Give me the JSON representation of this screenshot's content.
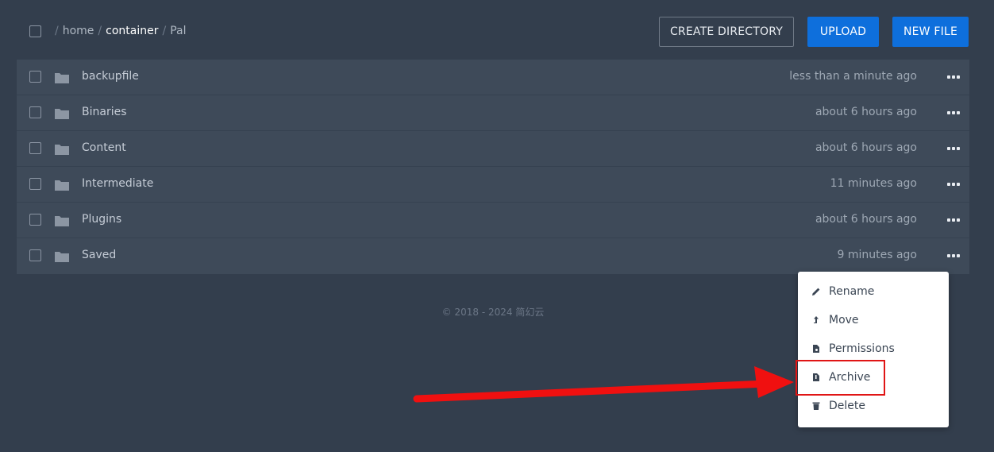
{
  "header": {
    "breadcrumb": {
      "sep": "/",
      "home": "home",
      "container": "container",
      "current": "Pal"
    },
    "buttons": {
      "create_directory": "CREATE DIRECTORY",
      "upload": "UPLOAD",
      "new_file": "NEW FILE"
    }
  },
  "files": [
    {
      "name": "backupfile",
      "modified": "less than a minute ago"
    },
    {
      "name": "Binaries",
      "modified": "about 6 hours ago"
    },
    {
      "name": "Content",
      "modified": "about 6 hours ago"
    },
    {
      "name": "Intermediate",
      "modified": "11 minutes ago"
    },
    {
      "name": "Plugins",
      "modified": "about 6 hours ago"
    },
    {
      "name": "Saved",
      "modified": "9 minutes ago"
    }
  ],
  "footer": {
    "text": "© 2018 - 2024 简幻云"
  },
  "context_menu": {
    "items": [
      {
        "label": "Rename",
        "icon": "pencil-icon"
      },
      {
        "label": "Move",
        "icon": "move-icon"
      },
      {
        "label": "Permissions",
        "icon": "permissions-icon"
      },
      {
        "label": "Archive",
        "icon": "archive-icon"
      },
      {
        "label": "Delete",
        "icon": "trash-icon"
      }
    ]
  },
  "colors": {
    "background": "#333e4d",
    "list_bg": "#3e4a59",
    "accent": "#0e6fdc",
    "annotation": "#e01515"
  }
}
